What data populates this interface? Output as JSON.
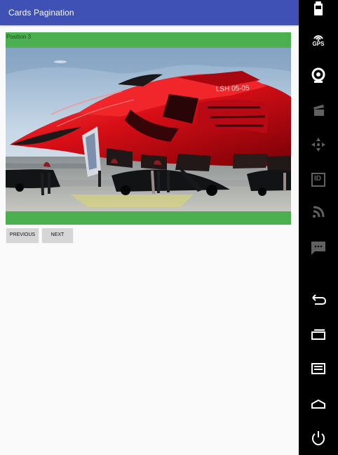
{
  "app": {
    "title": "Cards Pagination"
  },
  "card": {
    "position_label": "Position 3",
    "image_subject": "red-spaceship-hangar-image",
    "ship_marking": "LSH 05-05",
    "accent_color": "#4caf50"
  },
  "pagination": {
    "previous_label": "PREVIOUS",
    "next_label": "NEXT"
  },
  "side_controls": {
    "gps_label": "GPS",
    "id_label": "ID",
    "icons": [
      "battery-icon",
      "gps-icon",
      "camera-icon",
      "clapperboard-icon",
      "directional-pad-icon",
      "id-card-icon",
      "rss-feed-icon",
      "message-icon",
      "back-icon",
      "recent-apps-icon",
      "menu-icon",
      "home-icon",
      "power-icon"
    ]
  },
  "colors": {
    "toolbar": "#3f51b5",
    "background": "#fafafa",
    "card": "#4caf50",
    "button": "#d6d6d6",
    "rail": "#000000"
  }
}
